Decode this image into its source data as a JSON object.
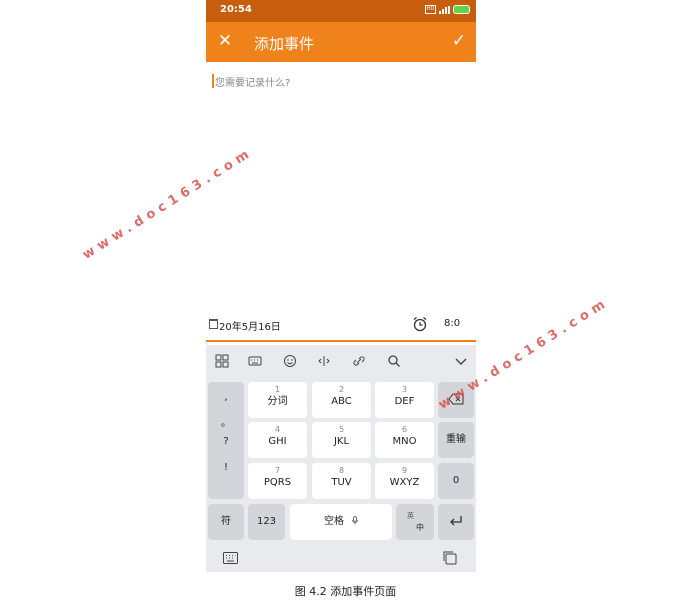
{
  "status": {
    "time": "20:54",
    "sim_label": "HD"
  },
  "toolbar": {
    "title": "添加事件",
    "close_icon": "✕",
    "confirm_icon": "✓"
  },
  "editor": {
    "placeholder": "您需要记录什么?",
    "value": ""
  },
  "meta": {
    "date": "20年5月16日",
    "alarm_time": "8:0"
  },
  "keyboard": {
    "toolbar_icons": [
      "grid-icon",
      "keyboard-icon",
      "emoji-icon",
      "cursor-icon",
      "clipboard-link-icon",
      "search-icon",
      "collapse-icon"
    ],
    "left_column": [
      ",",
      "。",
      "?",
      "!"
    ],
    "keys": [
      {
        "num": "1",
        "label": "分词"
      },
      {
        "num": "2",
        "label": "ABC"
      },
      {
        "num": "3",
        "label": "DEF"
      },
      {
        "num": "4",
        "label": "GHI"
      },
      {
        "num": "5",
        "label": "JKL"
      },
      {
        "num": "6",
        "label": "MNO"
      },
      {
        "num": "7",
        "label": "PQRS"
      },
      {
        "num": "8",
        "label": "TUV"
      },
      {
        "num": "9",
        "label": "WXYZ"
      }
    ],
    "right_column": {
      "reenter": "重输",
      "zero": "0"
    },
    "bottom": {
      "symbols": "符",
      "numbers": "123",
      "space": "空格",
      "lang_top": "英",
      "lang_bottom": "中"
    }
  },
  "caption": "图 4.2 添加事件页面",
  "watermarks": [
    "www.doc163.com",
    "www.doc163.com"
  ],
  "colors": {
    "toolbar": "#f0821c",
    "statusbar": "#c75e0d",
    "accent": "#f0821c"
  }
}
